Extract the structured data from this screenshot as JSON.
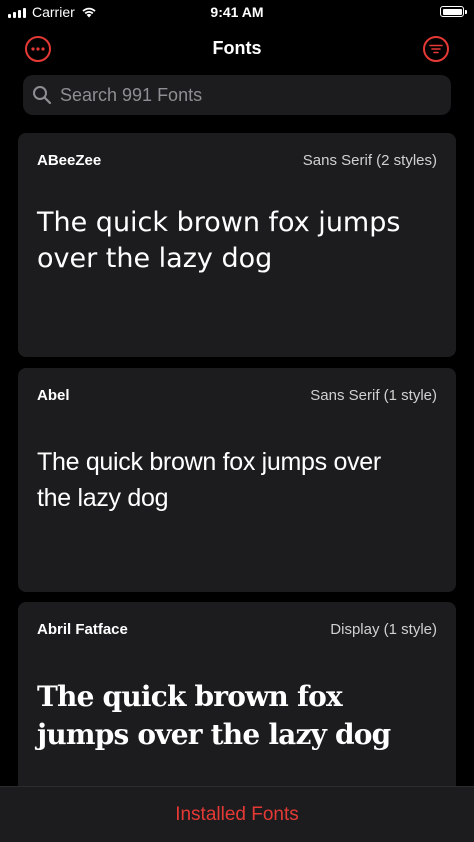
{
  "status_bar": {
    "carrier": "Carrier",
    "time": "9:41 AM"
  },
  "nav": {
    "title": "Fonts",
    "left_icon": "more-icon",
    "right_icon": "filter-icon"
  },
  "search": {
    "placeholder": "Search 991 Fonts"
  },
  "fonts": [
    {
      "name": "ABeeZee",
      "category": "Sans Serif (2 styles)",
      "sample": "The quick brown fox jumps over the lazy dog"
    },
    {
      "name": "Abel",
      "category": "Sans Serif (1 style)",
      "sample": "The quick brown fox jumps over the lazy dog"
    },
    {
      "name": "Abril Fatface",
      "category": "Display (1 style)",
      "sample": "The quick brown fox jumps over the lazy dog"
    }
  ],
  "bottom_bar": {
    "label": "Installed Fonts"
  },
  "colors": {
    "accent": "#e53935",
    "background": "#000000",
    "card": "#1c1c1e",
    "secondary_text": "#8e8e93"
  }
}
